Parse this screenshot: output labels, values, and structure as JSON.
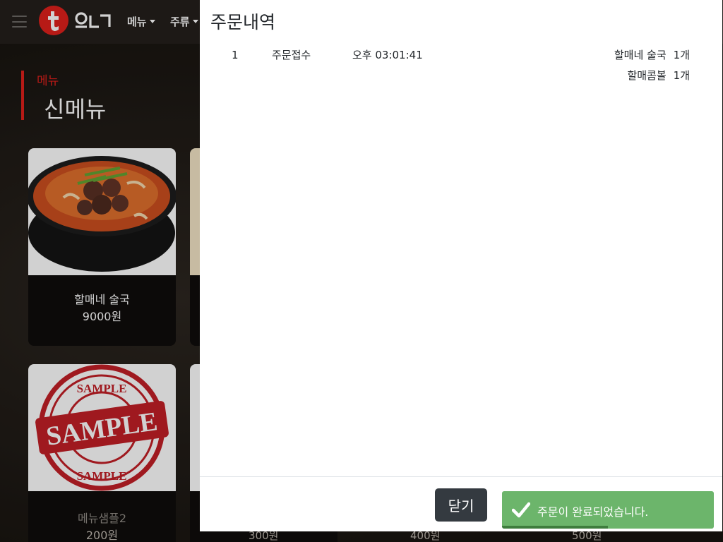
{
  "topbar": {
    "nav": [
      {
        "label": "메뉴"
      },
      {
        "label": "주류"
      }
    ]
  },
  "section": {
    "category": "메뉴",
    "title": "신메뉴"
  },
  "cards": [
    {
      "name": "할매네 술국",
      "price": "9000원",
      "image": "stew-icon"
    },
    {
      "name": "메뉴샘플2",
      "price": "200원",
      "image": "sample-stamp-icon",
      "stamp_text": "SAMPLE"
    }
  ],
  "bottom_prices": [
    "300원",
    "400원",
    "500원"
  ],
  "modal": {
    "title": "주문내역",
    "orders": [
      {
        "no": "1",
        "status": "주문접수",
        "time": "오후 03:01:41",
        "items": [
          {
            "name": "할매네 술국",
            "qty": "1개"
          },
          {
            "name": "할매콤볼",
            "qty": "1개"
          }
        ]
      }
    ],
    "close_label": "닫기"
  },
  "toast": {
    "message": "주문이 완료되었습니다.",
    "icon": "check-icon",
    "color": "#6cb56b",
    "progress": 0.5
  },
  "colors": {
    "accent": "#e0201b",
    "close_button": "#343a40"
  }
}
